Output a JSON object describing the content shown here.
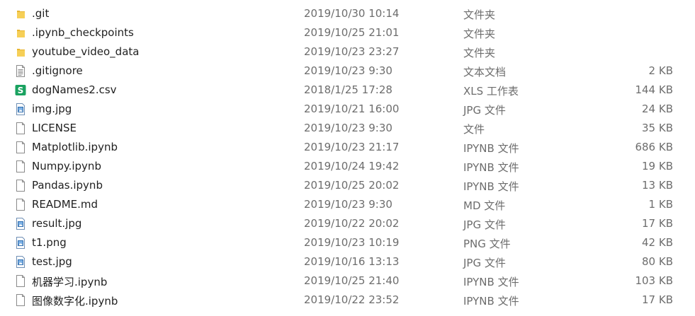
{
  "files": [
    {
      "name": ".git",
      "date": "2019/10/30 10:14",
      "type": "文件夹",
      "size": "",
      "icon": "folder-icon"
    },
    {
      "name": ".ipynb_checkpoints",
      "date": "2019/10/25 21:01",
      "type": "文件夹",
      "size": "",
      "icon": "folder-icon"
    },
    {
      "name": "youtube_video_data",
      "date": "2019/10/23 23:27",
      "type": "文件夹",
      "size": "",
      "icon": "folder-icon"
    },
    {
      "name": ".gitignore",
      "date": "2019/10/23 9:30",
      "type": "文本文档",
      "size": "2 KB",
      "icon": "text-file-icon"
    },
    {
      "name": "dogNames2.csv",
      "date": "2018/1/25 17:28",
      "type": "XLS 工作表",
      "size": "144 KB",
      "icon": "spreadsheet-icon"
    },
    {
      "name": "img.jpg",
      "date": "2019/10/21 16:00",
      "type": "JPG 文件",
      "size": "24 KB",
      "icon": "image-file-icon"
    },
    {
      "name": "LICENSE",
      "date": "2019/10/23 9:30",
      "type": "文件",
      "size": "35 KB",
      "icon": "generic-file-icon"
    },
    {
      "name": "Matplotlib.ipynb",
      "date": "2019/10/23 21:17",
      "type": "IPYNB 文件",
      "size": "686 KB",
      "icon": "generic-file-icon"
    },
    {
      "name": "Numpy.ipynb",
      "date": "2019/10/24 19:42",
      "type": "IPYNB 文件",
      "size": "19 KB",
      "icon": "generic-file-icon"
    },
    {
      "name": "Pandas.ipynb",
      "date": "2019/10/25 20:02",
      "type": "IPYNB 文件",
      "size": "13 KB",
      "icon": "generic-file-icon"
    },
    {
      "name": "README.md",
      "date": "2019/10/23 9:30",
      "type": "MD 文件",
      "size": "1 KB",
      "icon": "generic-file-icon"
    },
    {
      "name": "result.jpg",
      "date": "2019/10/22 20:02",
      "type": "JPG 文件",
      "size": "17 KB",
      "icon": "image-file-icon"
    },
    {
      "name": "t1.png",
      "date": "2019/10/23 10:19",
      "type": "PNG 文件",
      "size": "42 KB",
      "icon": "image-file-icon"
    },
    {
      "name": "test.jpg",
      "date": "2019/10/16 13:13",
      "type": "JPG 文件",
      "size": "80 KB",
      "icon": "image-file-icon"
    },
    {
      "name": "机器学习.ipynb",
      "date": "2019/10/25 21:40",
      "type": "IPYNB 文件",
      "size": "103 KB",
      "icon": "generic-file-icon"
    },
    {
      "name": "图像数字化.ipynb",
      "date": "2019/10/22 23:52",
      "type": "IPYNB 文件",
      "size": "17 KB",
      "icon": "generic-file-icon"
    }
  ],
  "colors": {
    "folder": "#f4c542",
    "spreadsheet": "#1aa260",
    "image": "#2b6cb0",
    "text_secondary": "#6d6d6d"
  }
}
